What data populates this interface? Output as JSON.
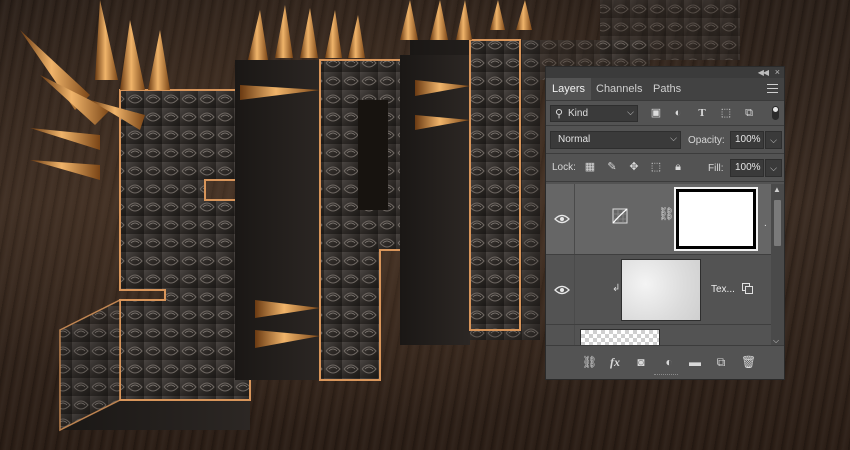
{
  "artwork": {
    "description_free": true,
    "letters": [
      "S",
      "P",
      "I",
      "K",
      "Y"
    ]
  },
  "panel": {
    "tabs": [
      {
        "label": "Layers",
        "active": true
      },
      {
        "label": "Channels",
        "active": false
      },
      {
        "label": "Paths",
        "active": false
      }
    ],
    "filter": {
      "kind_label": "Kind",
      "icons": [
        "image-filter-icon",
        "adjustment-filter-icon",
        "type-filter-icon",
        "shape-filter-icon",
        "smart-object-filter-icon",
        "filter-toggle-icon"
      ]
    },
    "blend": {
      "mode": "Normal",
      "opacity_label": "Opacity:",
      "opacity_value": "100%"
    },
    "lock": {
      "lock_label": "Lock:",
      "icons": [
        "lock-transparent-pixels-icon",
        "lock-image-pixels-icon",
        "lock-position-icon",
        "lock-artboard-icon",
        "lock-all-icon"
      ],
      "fill_label": "Fill:",
      "fill_value": "100%"
    },
    "layers": [
      {
        "name": "",
        "type": "adjustment",
        "visible": true,
        "selected": true
      },
      {
        "name": "Tex...",
        "type": "smart-object",
        "visible": true,
        "selected": false,
        "clipped": true
      },
      {
        "name": "",
        "type": "pixel",
        "visible": false,
        "selected": false
      }
    ],
    "bottom_icons": [
      "link-layers-icon",
      "fx-icon",
      "add-mask-icon",
      "new-adjustment-icon",
      "new-group-icon",
      "new-layer-icon",
      "delete-layer-icon"
    ],
    "fx_label": "fx"
  },
  "colors": {
    "panel_bg": "#535353",
    "selected_row": "#666666",
    "tab_bar": "#424242"
  }
}
